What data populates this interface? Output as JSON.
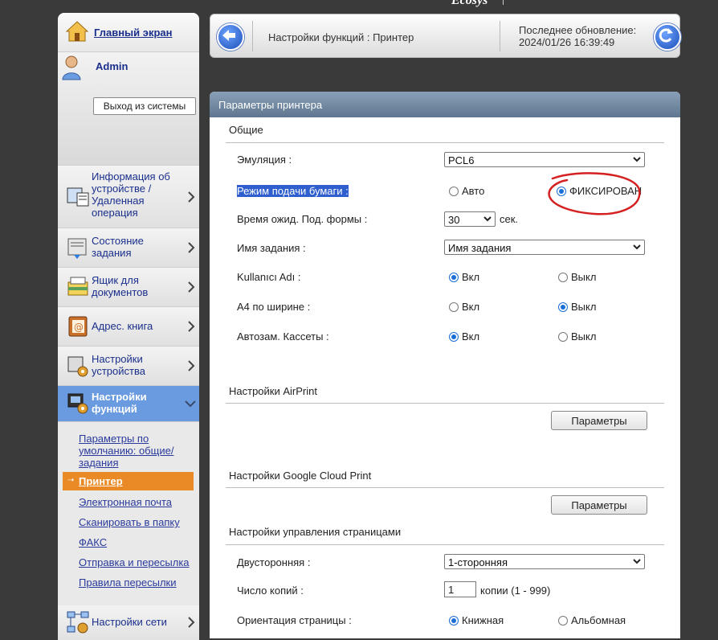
{
  "brand": "Ecosys",
  "sidebar": {
    "home_label": "Главный экран",
    "user_name": "Admin",
    "logout_label": "Выход из системы",
    "items": [
      {
        "label": "Информация об устройстве / Удаленная операция"
      },
      {
        "label": "Состояние задания"
      },
      {
        "label": "Ящик для документов"
      },
      {
        "label": "Адрес. книга"
      },
      {
        "label": "Настройки устройства"
      },
      {
        "label": "Настройки функций"
      },
      {
        "label": "Настройки сети"
      }
    ],
    "subitems": [
      {
        "label": "Параметры по умолчанию: общие/ задания"
      },
      {
        "label": "Принтер"
      },
      {
        "label": "Электронная почта"
      },
      {
        "label": "Сканировать в папку"
      },
      {
        "label": "ФАКС"
      },
      {
        "label": "Отправка и пересылка"
      },
      {
        "label": "Правила пересылки"
      }
    ]
  },
  "header": {
    "title": "Настройки функций : Принтер",
    "last_update_label": "Последнее обновление:",
    "last_update_value": "2024/01/26 16:39:49"
  },
  "panel": {
    "title": "Параметры принтера",
    "general": {
      "section": "Общие",
      "emulation_label": "Эмуляция :",
      "emulation_value": "PCL6",
      "paper_feed_label": "Режим подачи бумаги :",
      "paper_feed_auto": "Авто",
      "paper_feed_fixed": "ФИКСИРОВАН",
      "form_wait_label": "Время ожид. Под. формы :",
      "form_wait_value": "30",
      "form_wait_unit": "сек.",
      "job_name_label": "Имя задания :",
      "job_name_value": "Имя задания",
      "username_label": "Kullanıcı Adı :",
      "a4_wide_label": "A4 по ширине :",
      "auto_cassette_label": "Автозам. Кассеты :",
      "on_label": "Вкл",
      "off_label": "Выкл"
    },
    "airprint": {
      "section": "Настройки AirPrint",
      "button": "Параметры"
    },
    "cloudprint": {
      "section": "Настройки Google Cloud Print",
      "button": "Параметры"
    },
    "page_mgmt": {
      "section": "Настройки управления страницами",
      "duplex_label": "Двусторонняя :",
      "duplex_value": "1-сторонняя",
      "copies_label": "Число копий :",
      "copies_value": "1",
      "copies_unit": "копии (1 - 999)",
      "orientation_label": "Ориентация страницы :",
      "portrait": "Книжная",
      "landscape": "Альбомная"
    }
  },
  "colors": {
    "accent": "#e98a26",
    "active_nav": "#6a9be0",
    "link": "#1a2f8c",
    "annotation": "#d42020"
  }
}
